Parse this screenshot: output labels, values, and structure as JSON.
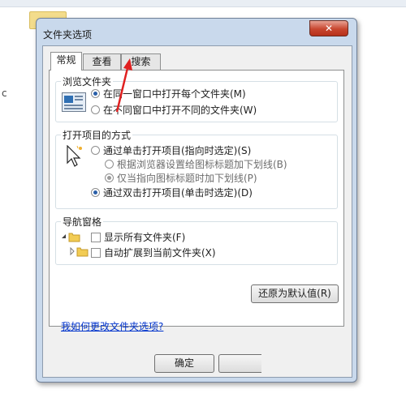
{
  "dialog": {
    "title": "文件夹选项",
    "close_glyph": "✕",
    "tabs": [
      {
        "label": "常规",
        "active": true
      },
      {
        "label": "查看",
        "active": false
      },
      {
        "label": "搜索",
        "active": false
      }
    ],
    "browse": {
      "legend": "浏览文件夹",
      "options": [
        {
          "label": "在同一窗口中打开每个文件夹(M)",
          "selected": true
        },
        {
          "label": "在不同窗口中打开不同的文件夹(W)",
          "selected": false
        }
      ]
    },
    "open_items": {
      "legend": "打开项目的方式",
      "options": [
        {
          "label": "通过单击打开项目(指向时选定)(S)",
          "selected": false
        },
        {
          "label": "根据浏览器设置给图标标题加下划线(B)",
          "selected": false,
          "disabled": true
        },
        {
          "label": "仅当指向图标标题时加下划线(P)",
          "selected": true,
          "disabled": true
        },
        {
          "label": "通过双击打开项目(单击时选定)(D)",
          "selected": true
        }
      ]
    },
    "nav_pane": {
      "legend": "导航窗格",
      "options": [
        {
          "label": "显示所有文件夹(F)",
          "checked": false
        },
        {
          "label": "自动扩展到当前文件夹(X)",
          "checked": false
        }
      ]
    },
    "restore_defaults_label": "还原为默认值(R)",
    "help_link": "我如何更改文件夹选项?",
    "ok_label": "确定"
  },
  "background": {
    "stray_text": "c"
  },
  "colors": {
    "annotation_arrow": "#e02020",
    "link": "#0033cc",
    "dialog_frame": "#c9d9ec"
  }
}
